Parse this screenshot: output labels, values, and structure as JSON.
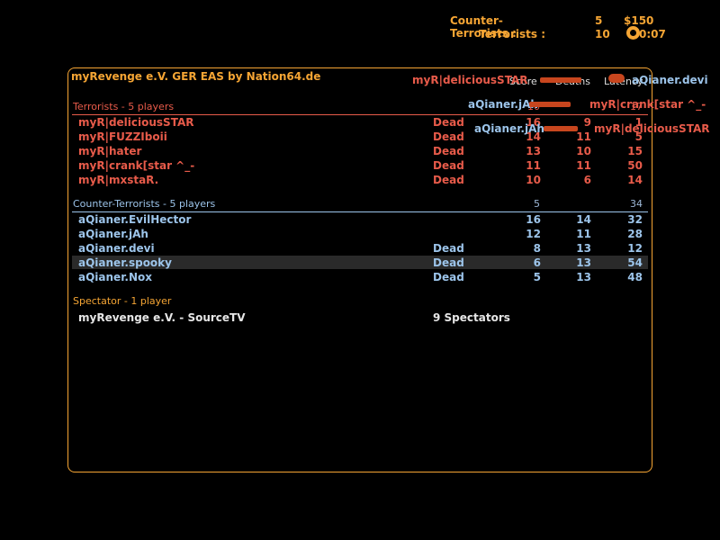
{
  "hud": {
    "ct_label": "Counter-Terrorists :",
    "ct_score": "5",
    "money": "$150",
    "t_label": "Terrorists :",
    "t_score": "10",
    "timer": "0:07"
  },
  "scoreboard": {
    "server_title": "myRevenge e.V. GER EAS by Nation64.de",
    "columns": {
      "score": "Score",
      "deaths": "Deaths",
      "latency": "Latency"
    },
    "terrorists": {
      "title": "Terrorists   -   5 players",
      "team_score": "10",
      "team_latency": "17",
      "players": [
        {
          "name": "myR|deliciousSTAR",
          "status": "Dead",
          "score": "16",
          "deaths": "9",
          "latency": "1"
        },
        {
          "name": "myR|FUZZIboii",
          "status": "Dead",
          "score": "14",
          "deaths": "11",
          "latency": "5"
        },
        {
          "name": "myR|hater",
          "status": "Dead",
          "score": "13",
          "deaths": "10",
          "latency": "15"
        },
        {
          "name": "myR|crank[star ^_-",
          "status": "Dead",
          "score": "11",
          "deaths": "11",
          "latency": "50"
        },
        {
          "name": "myR|mxstaR.",
          "status": "Dead",
          "score": "10",
          "deaths": "6",
          "latency": "14"
        }
      ]
    },
    "counter_terrorists": {
      "title": "Counter-Terrorists   -   5 players",
      "team_score": "5",
      "team_latency": "34",
      "players": [
        {
          "name": "aQianer.EvilHector",
          "status": "",
          "score": "16",
          "deaths": "14",
          "latency": "32"
        },
        {
          "name": "aQianer.jAh",
          "status": "",
          "score": "12",
          "deaths": "11",
          "latency": "28"
        },
        {
          "name": "aQianer.devi",
          "status": "Dead",
          "score": "8",
          "deaths": "13",
          "latency": "12"
        },
        {
          "name": "aQianer.spooky",
          "status": "Dead",
          "score": "6",
          "deaths": "13",
          "latency": "54"
        },
        {
          "name": "aQianer.Nox",
          "status": "Dead",
          "score": "5",
          "deaths": "13",
          "latency": "48"
        }
      ]
    },
    "spectators": {
      "title": "Spectator   -   1 player",
      "name": "myRevenge e.V. - SourceTV",
      "count": "9 Spectators"
    }
  },
  "killfeed": [
    {
      "killer": "myR|deliciousSTAR",
      "victim": "aQianer.devi",
      "weapon": "rifle-icon"
    },
    {
      "killer": "aQianer.jAh",
      "victim": "myR|crank[star ^_-",
      "weapon": "rifle-icon"
    },
    {
      "killer": "aQianer.jAh",
      "victim": "myR|deliciousSTAR",
      "weapon": "rifle-icon"
    }
  ],
  "colors": {
    "accent": "#f5a534",
    "terrorist": "#e85b4a",
    "counter_terrorist": "#9cc4ea"
  }
}
